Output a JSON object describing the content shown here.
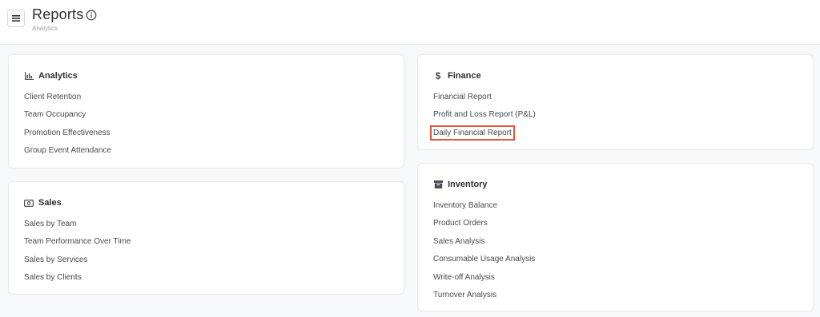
{
  "header": {
    "title": "Reports",
    "subtitle": "Analytics"
  },
  "cards": {
    "analytics": {
      "title": "Analytics",
      "icon": "bar-chart-icon",
      "items": [
        "Client Retention",
        "Team Occupancy",
        "Promotion Effectiveness",
        "Group Event Attendance"
      ]
    },
    "sales": {
      "title": "Sales",
      "icon": "cash-icon",
      "items": [
        "Sales by Team",
        "Team Performance Over Time",
        "Sales by Services",
        "Sales by Clients"
      ]
    },
    "finance": {
      "title": "Finance",
      "icon": "dollar-icon",
      "items": [
        "Financial Report",
        "Profit and Loss Report (P&L)",
        "Daily Financial Report"
      ]
    },
    "inventory": {
      "title": "Inventory",
      "icon": "archive-box-icon",
      "items": [
        "Inventory Balance",
        "Product Orders",
        "Sales Analysis",
        "Consumable Usage Analysis",
        "Write-off Analysis",
        "Turnover Analysis"
      ]
    }
  },
  "colors": {
    "background": "#f7f8fa",
    "card": "#ffffff",
    "highlight": "#e8513a"
  }
}
